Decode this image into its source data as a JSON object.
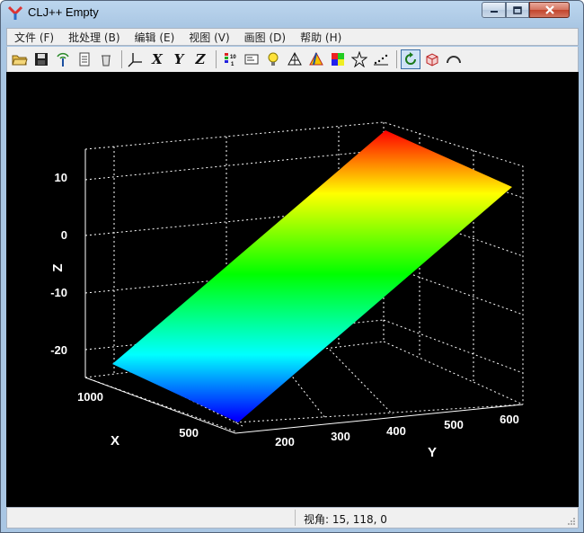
{
  "window": {
    "title": "CLJ++ Empty"
  },
  "menu": [
    {
      "label": "文件 (F)"
    },
    {
      "label": "批处理 (B)"
    },
    {
      "label": "编辑 (E)"
    },
    {
      "label": "视图 (V)"
    },
    {
      "label": "画图 (D)"
    },
    {
      "label": "帮助 (H)"
    }
  ],
  "toolbar": {
    "x_label": "X",
    "y_label": "Y",
    "z_label": "Z",
    "buttons": [
      "open-icon",
      "save-icon",
      "antenna-icon",
      "notes-icon",
      "recycle-icon",
      "axes-icon",
      "x-axis-button",
      "y-axis-button",
      "z-axis-button",
      "colorbar-icon",
      "label-icon",
      "light-icon",
      "mesh-cone-icon",
      "color-cone-icon",
      "color-palette-icon",
      "star-icon",
      "scatter-icon",
      "rotate-icon",
      "cube-export-icon",
      "arc-icon"
    ]
  },
  "plot": {
    "axis_labels": {
      "x": "X",
      "y": "Y",
      "z": "Z"
    },
    "z_ticks": [
      "10",
      "0",
      "-10",
      "-20"
    ],
    "x_ticks": [
      "1000",
      "500"
    ],
    "y_ticks": [
      "200",
      "300",
      "400",
      "500",
      "600"
    ],
    "colormap": [
      "#0000ff",
      "#00ffff",
      "#00ff00",
      "#ffff00",
      "#ff0000"
    ]
  },
  "status": {
    "view_text": "视角: 15, 118, 0"
  }
}
